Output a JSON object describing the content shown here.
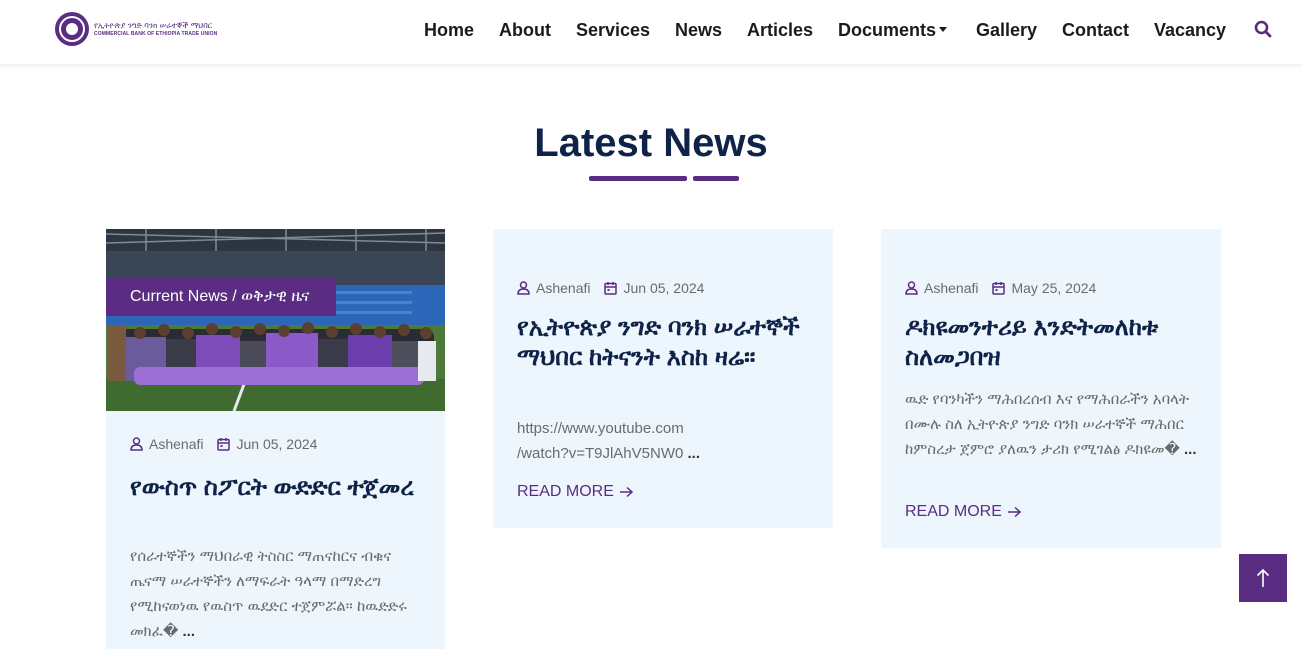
{
  "brand": {
    "logo_line1": "የኢትዮጵያ ንግድ ባንክ ሠራተኞች ማህበር",
    "logo_line2": "COMMERCIAL BANK OF ETHIOPIA TRADE UNION"
  },
  "nav": {
    "items": [
      "Home",
      "About",
      "Services",
      "News",
      "Articles",
      "Documents",
      "Gallery",
      "Contact",
      "Vacancy"
    ],
    "search_icon": "search-icon"
  },
  "section": {
    "title": "Latest News"
  },
  "cards": [
    {
      "category": "Current News / ወቅታዊ ዜና",
      "author": "Ashenafi",
      "date": "Jun 05, 2024",
      "title": "የውስጥ ስፖርት ውድድር ተጀመረ",
      "excerpt": "የሰራተኞችን ማህበራዊ ትስስር ማጠናከርና ብቁና ጤናማ ሠራተኞችን ለማፍራት ዓላማ በማድረግ የሚከናወነዉ የዉስጥ ዉደድር ተጀምሯል። ከዉድድሩ መክፈ�",
      "ellipsis": "..."
    },
    {
      "author": "Ashenafi",
      "date": "Jun 05, 2024",
      "title": "የኢትዮጵያ ንግድ ባንክ ሠራተኞች ማህበር ከትናንት እስከ ዛሬ።",
      "excerpt": "https://www.youtube.com /watch?v=T9JlAhV5NW0",
      "ellipsis": "...",
      "read_more": "READ MORE"
    },
    {
      "author": "Ashenafi",
      "date": "May 25, 2024",
      "title": "ዶክዩመንተሪይ እንድትመለከቱ ስለመጋበዝ",
      "excerpt": "ዉድ የባንካችን ማሕበረሰብ እና የማሕበራችን አባላት በሙሉ ስለ ኢትዮጵያ ንግድ ባንክ ሠራተኞች ማሕበር ከምስረታ ጀምሮ ያለዉን ታሪክ የሚገልፅ ዶክዩመ�",
      "ellipsis": "...",
      "read_more": "READ MORE"
    }
  ],
  "colors": {
    "brand_purple": "#5a2d82",
    "title_navy": "#0f2348",
    "card_bg": "#edf6fc"
  }
}
